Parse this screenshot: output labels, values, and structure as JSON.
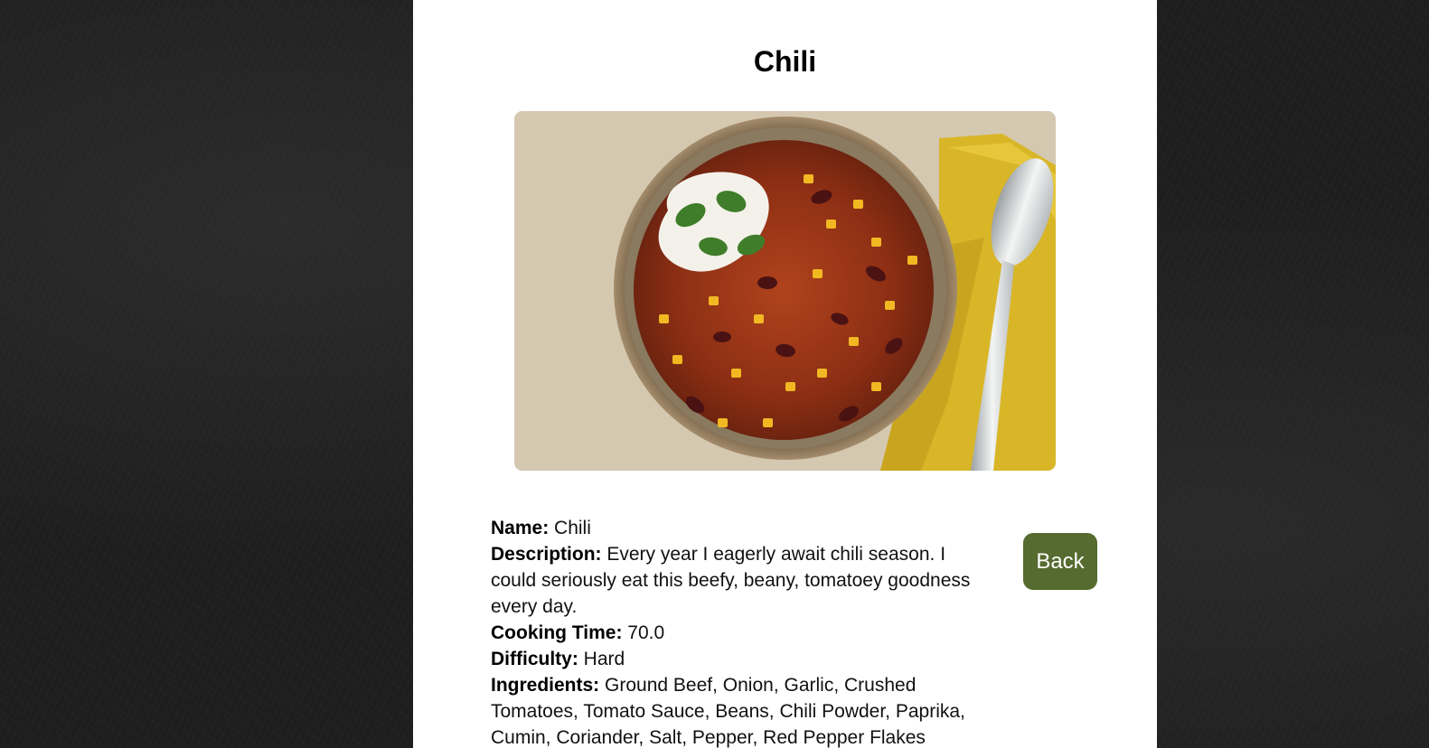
{
  "page": {
    "title": "Chili",
    "image_alt": "bowl-of-chili-photo"
  },
  "details": {
    "name_label": "Name:",
    "name_value": "Chili",
    "description_label": "Description:",
    "description_value": "Every year I eagerly await chili season. I could seriously eat this beefy, beany, tomatoey goodness every day.",
    "cooking_time_label": "Cooking Time:",
    "cooking_time_value": "70.0",
    "difficulty_label": "Difficulty:",
    "difficulty_value": "Hard",
    "ingredients_label": "Ingredients:",
    "ingredients_value": "Ground Beef, Onion, Garlic, Crushed Tomatoes, Tomato Sauce, Beans, Chili Powder, Paprika, Cumin, Coriander, Salt, Pepper, Red Pepper Flakes"
  },
  "actions": {
    "back_label": "Back"
  },
  "colors": {
    "background": "#1e1e1e",
    "panel": "#ffffff",
    "button": "#556b2f",
    "button_text": "#ffffff"
  }
}
